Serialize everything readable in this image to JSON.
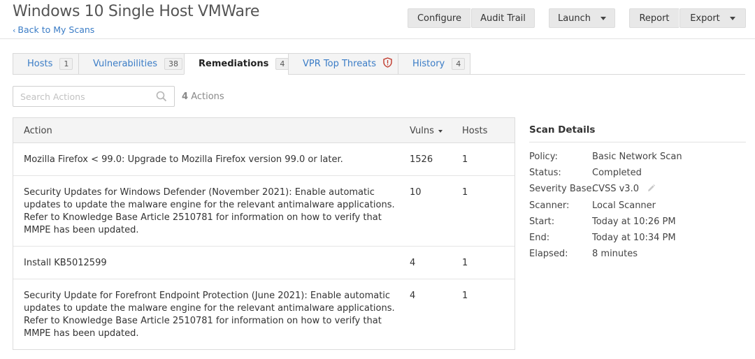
{
  "header": {
    "title": "Windows 10 Single Host VMWare",
    "back_link": "Back to My Scans",
    "buttons": {
      "configure": "Configure",
      "audit_trail": "Audit Trail",
      "launch": "Launch",
      "report": "Report",
      "export": "Export"
    }
  },
  "tabs": [
    {
      "label": "Hosts",
      "count": "1"
    },
    {
      "label": "Vulnerabilities",
      "count": "38"
    },
    {
      "label": "Remediations",
      "count": "4"
    },
    {
      "label": "VPR Top Threats",
      "icon": "shield-alert-icon"
    },
    {
      "label": "History",
      "count": "4"
    }
  ],
  "search": {
    "placeholder": "Search Actions",
    "count_number": "4",
    "count_label": "Actions"
  },
  "table": {
    "columns": {
      "action": "Action",
      "vulns": "Vulns",
      "hosts": "Hosts"
    },
    "rows": [
      {
        "action": "Mozilla Firefox < 99.0: Upgrade to Mozilla Firefox version 99.0 or later.",
        "vulns": "1526",
        "hosts": "1"
      },
      {
        "action": "Security Updates for Windows Defender (November 2021): Enable automatic updates to update the malware engine for the relevant antimalware applications. Refer to Knowledge Base Article 2510781 for information on how to verify that MMPE has been updated.",
        "vulns": "10",
        "hosts": "1"
      },
      {
        "action": "Install KB5012599",
        "vulns": "4",
        "hosts": "1"
      },
      {
        "action": "Security Update for Forefront Endpoint Protection (June 2021): Enable automatic updates to update the malware engine for the relevant antimalware applications. Refer to Knowledge Base Article 2510781 for information on how to verify that MMPE has been updated.",
        "vulns": "4",
        "hosts": "1"
      }
    ]
  },
  "scan_details": {
    "title": "Scan Details",
    "items": [
      {
        "key": "Policy:",
        "value": "Basic Network Scan"
      },
      {
        "key": "Status:",
        "value": "Completed"
      },
      {
        "key": "Severity Base:",
        "value": "CVSS v3.0"
      },
      {
        "key": "Scanner:",
        "value": "Local Scanner"
      },
      {
        "key": "Start:",
        "value": "Today at 10:26 PM"
      },
      {
        "key": "End:",
        "value": "Today at 10:34 PM"
      },
      {
        "key": "Elapsed:",
        "value": "8 minutes"
      }
    ]
  },
  "colors": {
    "link": "#3a7cc6",
    "shield": "#c0392b",
    "button_bg": "#e8e8e8"
  }
}
